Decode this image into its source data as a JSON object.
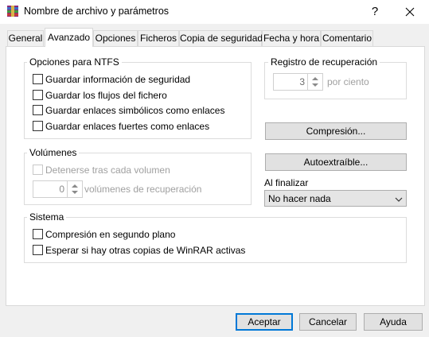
{
  "window": {
    "title": "Nombre de archivo y parámetros",
    "help_label": "?",
    "icons": {
      "app": "winrar-icon",
      "close": "close-icon"
    }
  },
  "tabs": [
    {
      "label": "General",
      "active": false
    },
    {
      "label": "Avanzado",
      "active": true
    },
    {
      "label": "Opciones",
      "active": false
    },
    {
      "label": "Ficheros",
      "active": false
    },
    {
      "label": "Copia de seguridad",
      "active": false
    },
    {
      "label": "Fecha y hora",
      "active": false
    },
    {
      "label": "Comentario",
      "active": false
    }
  ],
  "ntfs": {
    "title": "Opciones para NTFS",
    "options": [
      {
        "label": "Guardar información de seguridad",
        "checked": false
      },
      {
        "label": "Guardar los flujos del fichero",
        "checked": false
      },
      {
        "label": "Guardar enlaces simbólicos como enlaces",
        "checked": false
      },
      {
        "label": "Guardar enlaces fuertes como enlaces",
        "checked": false
      }
    ]
  },
  "recovery": {
    "title": "Registro de recuperación",
    "value": "3",
    "suffix": "por ciento"
  },
  "buttons": {
    "compression": "Compresión...",
    "sfx": "Autoextraíble...",
    "ok": "Aceptar",
    "cancel": "Cancelar",
    "help": "Ayuda"
  },
  "volumes": {
    "title": "Volúmenes",
    "pause_label": "Detenerse tras cada volumen",
    "recovery_value": "0",
    "recovery_suffix": "volúmenes de recuperación"
  },
  "finish": {
    "label": "Al finalizar",
    "selected": "No hacer nada"
  },
  "system": {
    "title": "Sistema",
    "options": [
      {
        "label": "Compresión en segundo plano",
        "checked": false
      },
      {
        "label": "Esperar si hay otras copias de WinRAR activas",
        "checked": false
      }
    ]
  },
  "colors": {
    "accent": "#0078d7",
    "dialog_bg": "#f0f0f0",
    "panel_bg": "#ffffff",
    "disabled_text": "#a0a0a0"
  }
}
